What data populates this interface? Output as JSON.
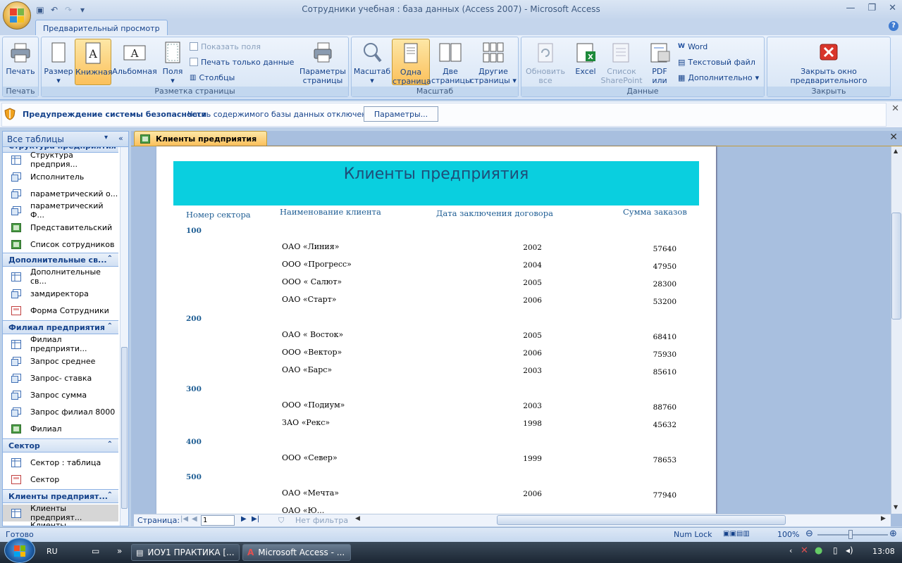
{
  "window": {
    "title": "Сотрудники учебная : база данных (Access 2007)  -  Microsoft Access",
    "minimize": "—",
    "maximize": "❐",
    "close": "✕"
  },
  "ribbon": {
    "active_tab": "Предварительный просмотр",
    "groups": {
      "print": {
        "label": "Печать",
        "print_button": "Печать"
      },
      "layout": {
        "label": "Разметка страницы",
        "size": "Размер",
        "portrait": "Книжная",
        "landscape": "Альбомная",
        "margins": "Поля",
        "show_margins": "Показать поля",
        "print_data_only": "Печать только данные",
        "columns": "Столбцы",
        "page_setup_line1": "Параметры",
        "page_setup_line2": "страницы"
      },
      "zoom": {
        "label": "Масштаб",
        "zoom": "Масштаб",
        "one_page_line1": "Одна",
        "one_page_line2": "страница",
        "two_pages_line1": "Две",
        "two_pages_line2": "страницы",
        "more_pages_line1": "Другие",
        "more_pages_line2": "страницы"
      },
      "data": {
        "label": "Данные",
        "refresh_line1": "Обновить",
        "refresh_line2": "все",
        "excel": "Excel",
        "sharepoint_line1": "Список",
        "sharepoint_line2": "SharePoint",
        "pdf_line1": "PDF",
        "pdf_line2": "или XPS",
        "word": "Word",
        "text_file": "Текстовый файл",
        "more": "Дополнительно"
      },
      "close": {
        "label": "Закрыть",
        "close_preview_line1": "Закрыть окно",
        "close_preview_line2": "предварительного просмотра"
      }
    }
  },
  "security_bar": {
    "title": "Предупреждение системы безопасности",
    "message": "Часть содержимого базы данных отключено",
    "options_button": "Параметры..."
  },
  "nav_pane": {
    "header": "Все таблицы",
    "partial_group": "Структура предприятия",
    "groups": [
      {
        "name": "Дополнительные св...",
        "items": [
          "Дополнительные св...",
          "замдиректора",
          "Форма Сотрудники"
        ]
      },
      {
        "name": "Филиал предприятия",
        "items": [
          "Филиал предприяти...",
          "Запрос среднее",
          "Запрос- ставка",
          "Запрос сумма",
          "Запрос филиал 8000",
          "Филиал"
        ]
      },
      {
        "name": "Сектор",
        "items": [
          "Сектор : таблица",
          "Сектор"
        ]
      },
      {
        "name": "Клиенты предприят...",
        "items": [
          "Клиенты предприят...",
          "Клиенты предприят..."
        ]
      }
    ],
    "top_items": [
      "Структура предприя...",
      "Исполнитель",
      "параметрический о...",
      "параметрический Ф...",
      "Представительский",
      "Список сотрудников"
    ]
  },
  "document": {
    "tab_title": "Клиенты предприятия",
    "report": {
      "title": "Клиенты предприятия",
      "columns": [
        "Номер сектора",
        "Наименование клиента",
        "Дата заключения договора",
        "Сумма заказов"
      ],
      "sectors": [
        {
          "sector": "100",
          "rows": [
            {
              "name": "ОАО «Линия»",
              "year": "2002",
              "sum": "57640"
            },
            {
              "name": "ООО «Прогресс»",
              "year": "2004",
              "sum": "47950"
            },
            {
              "name": "ООО « Салют»",
              "year": "2005",
              "sum": "28300"
            },
            {
              "name": "ОАО «Старт»",
              "year": "2006",
              "sum": "53200"
            }
          ]
        },
        {
          "sector": "200",
          "rows": [
            {
              "name": "ОАО « Восток»",
              "year": "2005",
              "sum": "68410"
            },
            {
              "name": "ООО «Вектор»",
              "year": "2006",
              "sum": "75930"
            },
            {
              "name": "ОАО «Барс»",
              "year": "2003",
              "sum": "85610"
            }
          ]
        },
        {
          "sector": "300",
          "rows": [
            {
              "name": "ООО «Подиум»",
              "year": "2003",
              "sum": "88760"
            },
            {
              "name": "ЗАО «Рекс»",
              "year": "1998",
              "sum": "45632"
            }
          ]
        },
        {
          "sector": "400",
          "rows": [
            {
              "name": "ООО «Север»",
              "year": "1999",
              "sum": "78653"
            }
          ]
        },
        {
          "sector": "500",
          "rows": [
            {
              "name": "ОАО «Мечта»",
              "year": "2006",
              "sum": "77940"
            },
            {
              "name": "ОАО «Ю...",
              "year": "",
              "sum": ""
            }
          ]
        }
      ]
    },
    "page_nav": {
      "label": "Страница:",
      "current": "1",
      "filter": "Нет фильтра"
    }
  },
  "status_bar": {
    "left": "Готово",
    "num_lock": "Num Lock",
    "zoom": "100%"
  },
  "taskbar": {
    "lang": "RU",
    "task1": "ИОУ1 ПРАКТИКА [...",
    "task2": "Microsoft Access - ...",
    "time": "13:08"
  }
}
